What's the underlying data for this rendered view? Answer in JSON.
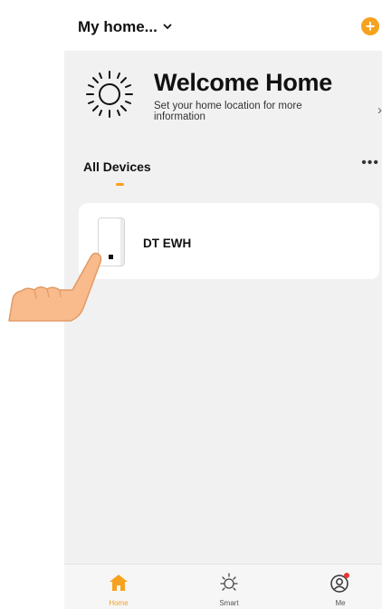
{
  "header": {
    "home_name": "My home...",
    "chevron_icon": "chevron-down-icon",
    "add_icon": "plus-circle-icon",
    "accent_color": "#f6a21e"
  },
  "welcome": {
    "title": "Welcome Home",
    "subtitle": "Set your home location for more information",
    "icon": "sun-icon",
    "arrow_icon": "chevron-right-icon"
  },
  "devices_section": {
    "title": "All Devices",
    "more_icon": "more-horizontal-icon"
  },
  "devices": [
    {
      "name": "DT EWH",
      "icon": "water-heater-icon"
    }
  ],
  "tabbar": {
    "tabs": [
      {
        "label": "Home",
        "icon": "home-icon",
        "active": true
      },
      {
        "label": "Smart",
        "icon": "sun-icon",
        "active": false
      },
      {
        "label": "Me",
        "icon": "user-icon",
        "active": false,
        "badge": true
      }
    ]
  },
  "overlay": {
    "icon": "pointing-hand-icon"
  }
}
